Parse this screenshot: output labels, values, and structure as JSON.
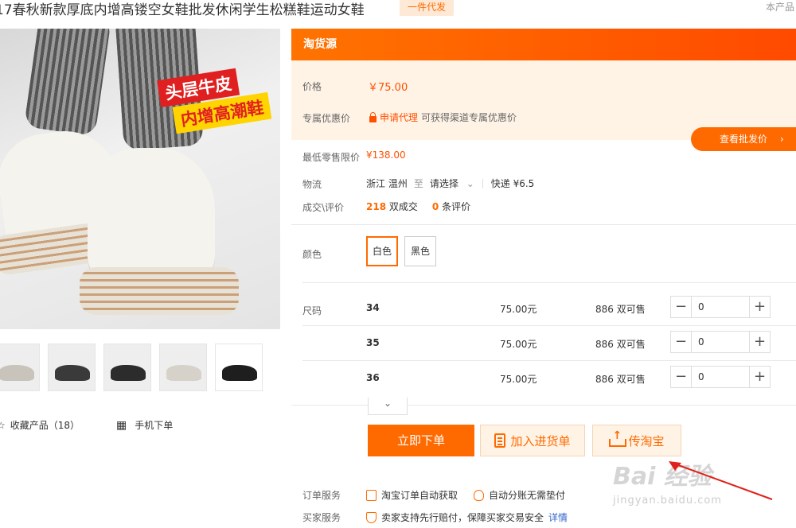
{
  "header": {
    "title": "17春秋新款厚底内增高镂空女鞋批发休闲学生松糕鞋运动女鞋",
    "dropship_tag": "一件代发",
    "report_link": "本产品"
  },
  "gallery": {
    "badge_line1": "头层牛皮",
    "badge_line2": "内增高潮鞋",
    "thumb_colors": [
      "#c9c4bb",
      "#3a3a3a",
      "#2c2c2c",
      "#d7d2c9",
      "#1e1e1e"
    ]
  },
  "side_actions": {
    "favorite_label": "收藏产品（18）",
    "mobile_order_label": "手机下单"
  },
  "panel": {
    "header": "淘货源",
    "price_label": "价格",
    "price_value": "￥75.00",
    "discount_label": "专属优惠价",
    "apply_agent": "申请代理",
    "apply_desc": "可获得渠道专属优惠价",
    "wholesale_button": "查看批发价",
    "min_price_label": "最低零售限价",
    "min_price_value": "¥138.00",
    "logistics_label": "物流",
    "origin": "浙江 温州",
    "to": "至",
    "destination": "请选择",
    "shipping": "快递 ¥6.5",
    "deals_label": "成交\\评价",
    "deals_count": "218",
    "deals_unit": "双成交",
    "reviews_count": "0",
    "reviews_unit": "条评价",
    "color_label": "颜色",
    "colors": [
      "白色",
      "黑色"
    ],
    "size_label": "尺码",
    "sizes": [
      {
        "size": "34",
        "price": "75.00元",
        "stock": "886 双可售",
        "qty": "0"
      },
      {
        "size": "35",
        "price": "75.00元",
        "stock": "886 双可售",
        "qty": "0"
      },
      {
        "size": "36",
        "price": "75.00元",
        "stock": "886 双可售",
        "qty": "0"
      }
    ],
    "buy_now": "立即下单",
    "add_to_list": "加入进货单",
    "upload_taobao": "传淘宝",
    "order_service_label": "订单服务",
    "order_service_1": "淘宝订单自动获取",
    "order_service_2": "自动分账无需垫付",
    "buyer_service_label": "买家服务",
    "buyer_service_1": "卖家支持先行赔付，保障买家交易安全",
    "buyer_detail": "详情"
  },
  "watermark": {
    "line1": "Bai 经验",
    "line2": "jingyan.baidu.com"
  }
}
